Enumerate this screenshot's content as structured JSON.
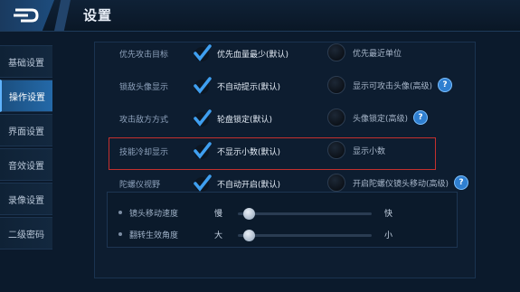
{
  "header": {
    "title": "设置"
  },
  "sidebar": {
    "items": [
      {
        "label": "基础设置",
        "active": false
      },
      {
        "label": "操作设置",
        "active": true
      },
      {
        "label": "界面设置",
        "active": false
      },
      {
        "label": "音效设置",
        "active": false
      },
      {
        "label": "录像设置",
        "active": false
      },
      {
        "label": "二级密码",
        "active": false
      }
    ]
  },
  "settings": {
    "attack_target": {
      "label": "优先攻击目标",
      "opt1": "优先血量最少(默认)",
      "opt2": "优先最近单位"
    },
    "lock_avatar": {
      "label": "锁敌头像显示",
      "opt1": "不自动提示(默认)",
      "opt2": "显示可攻击头像(高级)"
    },
    "attack_mode": {
      "label": "攻击敌方方式",
      "opt1": "轮盘锁定(默认)",
      "opt2": "头像锁定(高级)"
    },
    "cooldown": {
      "label": "技能冷却显示",
      "opt1": "不显示小数(默认)",
      "opt2": "显示小数"
    },
    "gyro": {
      "label": "陀螺仪视野",
      "opt1": "不自动开启(默认)",
      "opt2": "开启陀螺仪镜头移动(高级)"
    }
  },
  "sliders": {
    "move_speed": {
      "label": "镜头移动速度",
      "lo": "慢",
      "hi": "快",
      "value": 0.08
    },
    "flip_angle": {
      "label": "翻转生效角度",
      "lo": "大",
      "hi": "小",
      "value": 0.08
    }
  },
  "help_glyph": "?",
  "colors": {
    "accent": "#2f7fd0",
    "highlight": "#c4302e",
    "active_tab": "#2469a8"
  }
}
